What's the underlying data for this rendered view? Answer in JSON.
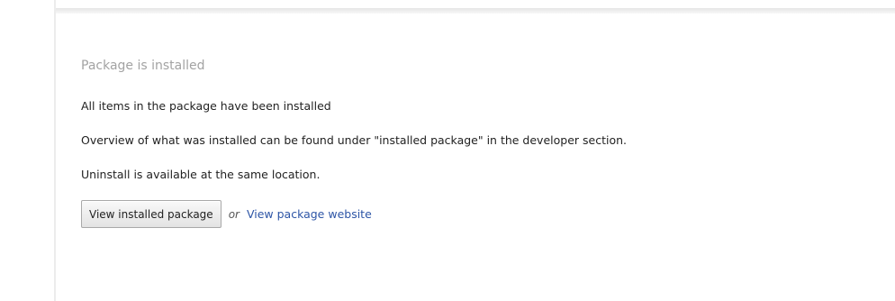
{
  "panel": {
    "title": "Package is installed",
    "lines": [
      "All items in the package have been installed",
      "Overview of what was installed can be found under \"installed package\" in the developer section.",
      "Uninstall is available at the same location."
    ],
    "actions": {
      "view_installed_label": "View installed package",
      "separator": "or",
      "website_link": "View package website"
    }
  },
  "colors": {
    "title": "#a3a3a3",
    "text": "#222222",
    "link": "#2d55a6"
  }
}
